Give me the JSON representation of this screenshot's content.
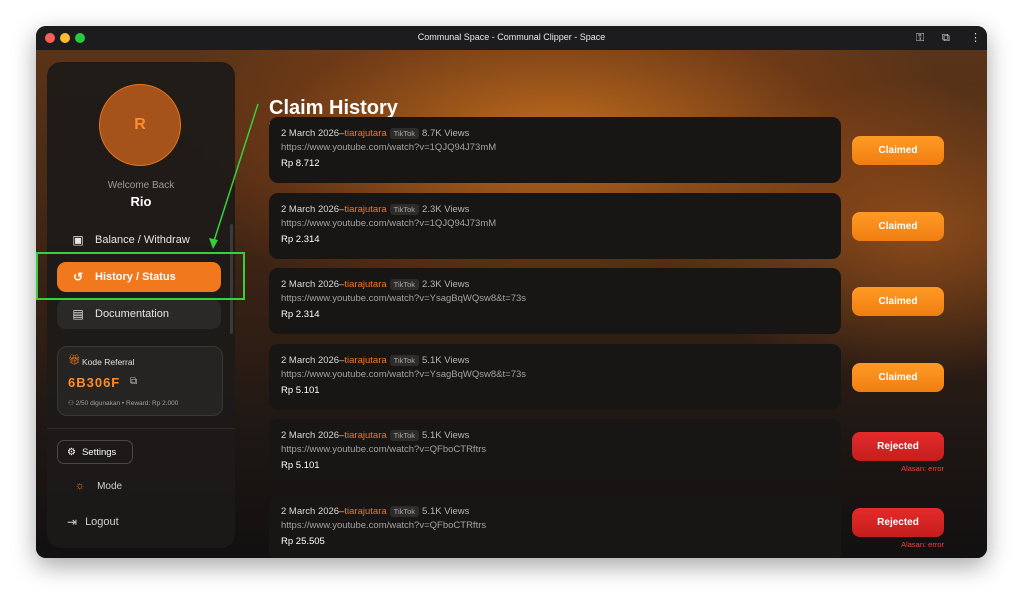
{
  "window": {
    "title": "Communal Space - Communal Clipper - Space"
  },
  "toolbar": {
    "key_icon": "key-icon",
    "extension_icon": "puzzle-icon",
    "menu_icon": "kebab-menu-icon"
  },
  "sidebar": {
    "avatar_initial": "R",
    "welcome": "Welcome Back",
    "username": "Rio",
    "items": [
      {
        "label": "Balance / Withdraw",
        "icon": "wallet-icon"
      },
      {
        "label": "History / Status",
        "icon": "history-icon",
        "active": true
      },
      {
        "label": "Documentation",
        "icon": "document-icon"
      }
    ],
    "referral": {
      "label": "Kode Referral",
      "code": "6B306F",
      "usage": "2/50 digunakan",
      "reward": "Reward: Rp 2.000"
    },
    "settings_label": "Settings",
    "mode_label": "Mode",
    "logout_label": "Logout"
  },
  "main": {
    "title": "Claim History",
    "claims": [
      {
        "date": "2 March 2026",
        "sep": " – ",
        "user": "tiarajutara",
        "platform": "TikTok",
        "views": "8.7K Views",
        "url": "https://www.youtube.com/watch?v=1QJQ94J73mM",
        "amount": "Rp 8.712",
        "status": "Claimed",
        "reason": ""
      },
      {
        "date": "2 March 2026",
        "sep": " – ",
        "user": "tiarajutara",
        "platform": "TikTok",
        "views": "2.3K Views",
        "url": "https://www.youtube.com/watch?v=1QJQ94J73mM",
        "amount": "Rp 2.314",
        "status": "Claimed",
        "reason": ""
      },
      {
        "date": "2 March 2026",
        "sep": " – ",
        "user": "tiarajutara",
        "platform": "TikTok",
        "views": "2.3K Views",
        "url": "https://www.youtube.com/watch?v=YsagBqWQsw8&t=73s",
        "amount": "Rp 2.314",
        "status": "Claimed",
        "reason": ""
      },
      {
        "date": "2 March 2026",
        "sep": " – ",
        "user": "tiarajutara",
        "platform": "TikTok",
        "views": "5.1K Views",
        "url": "https://www.youtube.com/watch?v=YsagBqWQsw8&t=73s",
        "amount": "Rp 5.101",
        "status": "Claimed",
        "reason": ""
      },
      {
        "date": "2 March 2026",
        "sep": " – ",
        "user": "tiarajutara",
        "platform": "TikTok",
        "views": "5.1K Views",
        "url": "https://www.youtube.com/watch?v=QFboCTRftrs",
        "amount": "Rp 5.101",
        "status": "Rejected",
        "reason": "Alasan: error"
      },
      {
        "date": "2 March 2026",
        "sep": " – ",
        "user": "tiarajutara",
        "platform": "TikTok",
        "views": "5.1K Views",
        "url": "https://www.youtube.com/watch?v=QFboCTRftrs",
        "amount": "Rp 25.505",
        "status": "Rejected",
        "reason": "Alasan: error"
      }
    ]
  },
  "colors": {
    "accent": "#f2781d",
    "claimed": "#f7891c",
    "rejected": "#d52424",
    "annotation": "#36d13a"
  }
}
